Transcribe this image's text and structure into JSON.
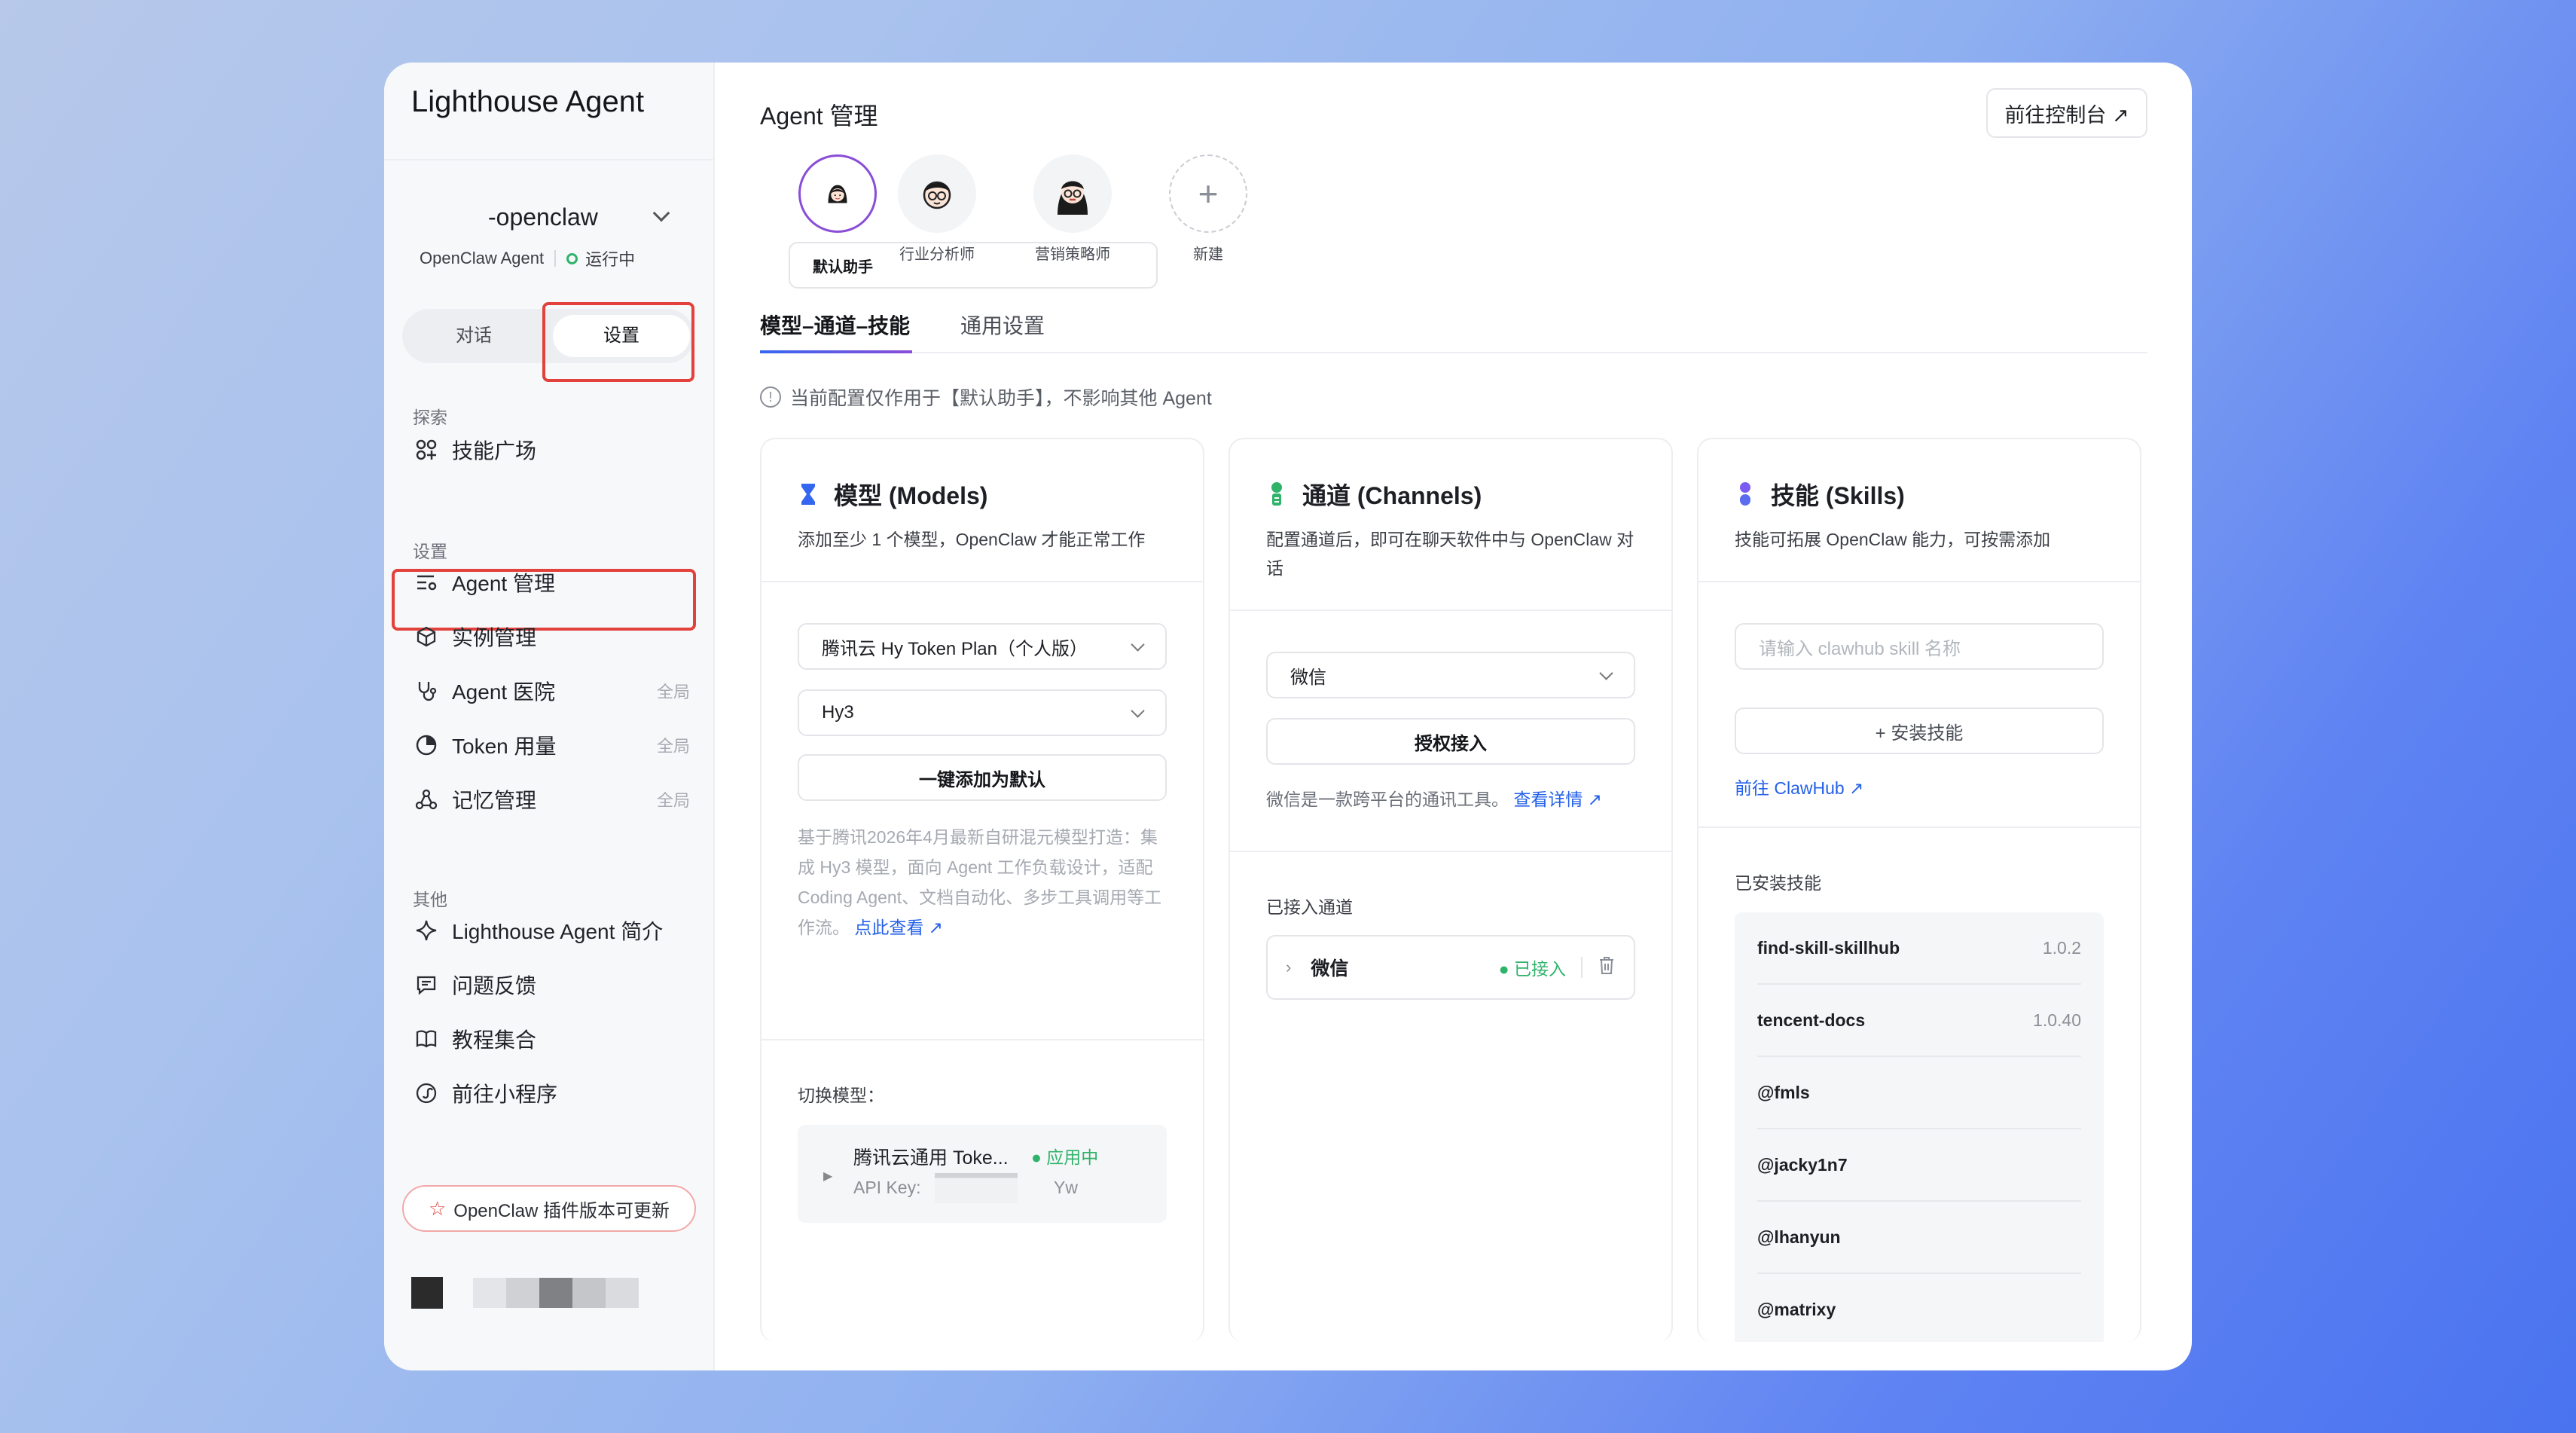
{
  "sidebar": {
    "app_title": "Lighthouse Agent",
    "instance_name": "-openclaw",
    "instance_type": "OpenClaw Agent",
    "instance_status": "运行中",
    "mode_tabs": [
      "对话",
      "设置"
    ],
    "sections": [
      {
        "label": "探索",
        "items": [
          {
            "label": "技能广场",
            "tag": ""
          }
        ]
      },
      {
        "label": "设置",
        "items": [
          {
            "label": "Agent 管理",
            "tag": ""
          },
          {
            "label": "实例管理",
            "tag": ""
          },
          {
            "label": "Agent 医院",
            "tag": "全局"
          },
          {
            "label": "Token 用量",
            "tag": "全局"
          },
          {
            "label": "记忆管理",
            "tag": "全局"
          }
        ]
      },
      {
        "label": "其他",
        "items": [
          {
            "label": "Lighthouse Agent 简介",
            "tag": ""
          },
          {
            "label": "问题反馈",
            "tag": ""
          },
          {
            "label": "教程集合",
            "tag": ""
          },
          {
            "label": "前往小程序",
            "tag": ""
          }
        ]
      }
    ],
    "update_banner": "OpenClaw 插件版本可更新"
  },
  "header": {
    "title": "Agent 管理",
    "console_button": "前往控制台 ↗"
  },
  "agents": [
    {
      "label": "默认助手"
    },
    {
      "label": "行业分析师"
    },
    {
      "label": "营销策略师"
    },
    {
      "label": "新建"
    }
  ],
  "tabs": [
    "模型–通道–技能",
    "通用设置"
  ],
  "notice": "当前配置仅作用于【默认助手】，不影响其他 Agent",
  "models": {
    "title": "模型 (Models)",
    "desc": "添加至少 1 个模型，OpenClaw 才能正常工作",
    "plan_select": "腾讯云 Hy Token Plan（个人版）",
    "model_select": "Hy3",
    "add_default_button": "一键添加为默认",
    "info": "基于腾讯2026年4月最新自研混元模型打造：集成 Hy3 模型，面向 Agent 工作负载设计，适配 Coding Agent、文档自动化、多步工具调用等工作流。",
    "info_link": "点此查看 ↗",
    "switch_label": "切换模型：",
    "current_model": "腾讯云通用 Toke...",
    "current_status": "● 应用中",
    "api_key_label": "API Key:",
    "api_key_tail": "Yw"
  },
  "channels": {
    "title": "通道 (Channels)",
    "desc": "配置通道后，即可在聊天软件中与 OpenClaw 对话",
    "select": "微信",
    "auth_button": "授权接入",
    "info": "微信是一款跨平台的通讯工具。",
    "info_link": "查看详情 ↗",
    "connected_label": "已接入通道",
    "connected": [
      {
        "name": "微信",
        "status": "● 已接入"
      }
    ]
  },
  "skills": {
    "title": "技能 (Skills)",
    "desc": "技能可拓展 OpenClaw 能力，可按需添加",
    "search_placeholder": "请输入 clawhub skill 名称",
    "install_button": "+ 安装技能",
    "hub_link": "前往 ClawHub ↗",
    "installed_label": "已安装技能",
    "installed": [
      {
        "name": "find-skill-skillhub",
        "version": "1.0.2"
      },
      {
        "name": "tencent-docs",
        "version": "1.0.40"
      },
      {
        "name": "@fmls",
        "version": ""
      },
      {
        "name": "@jacky1n7",
        "version": ""
      },
      {
        "name": "@lhanyun",
        "version": ""
      },
      {
        "name": "@matrixy",
        "version": ""
      }
    ]
  },
  "colors": {
    "accent": "#8a4dd8",
    "link": "#2461e8",
    "success": "#2fb36b",
    "highlight": "#e2423b"
  }
}
